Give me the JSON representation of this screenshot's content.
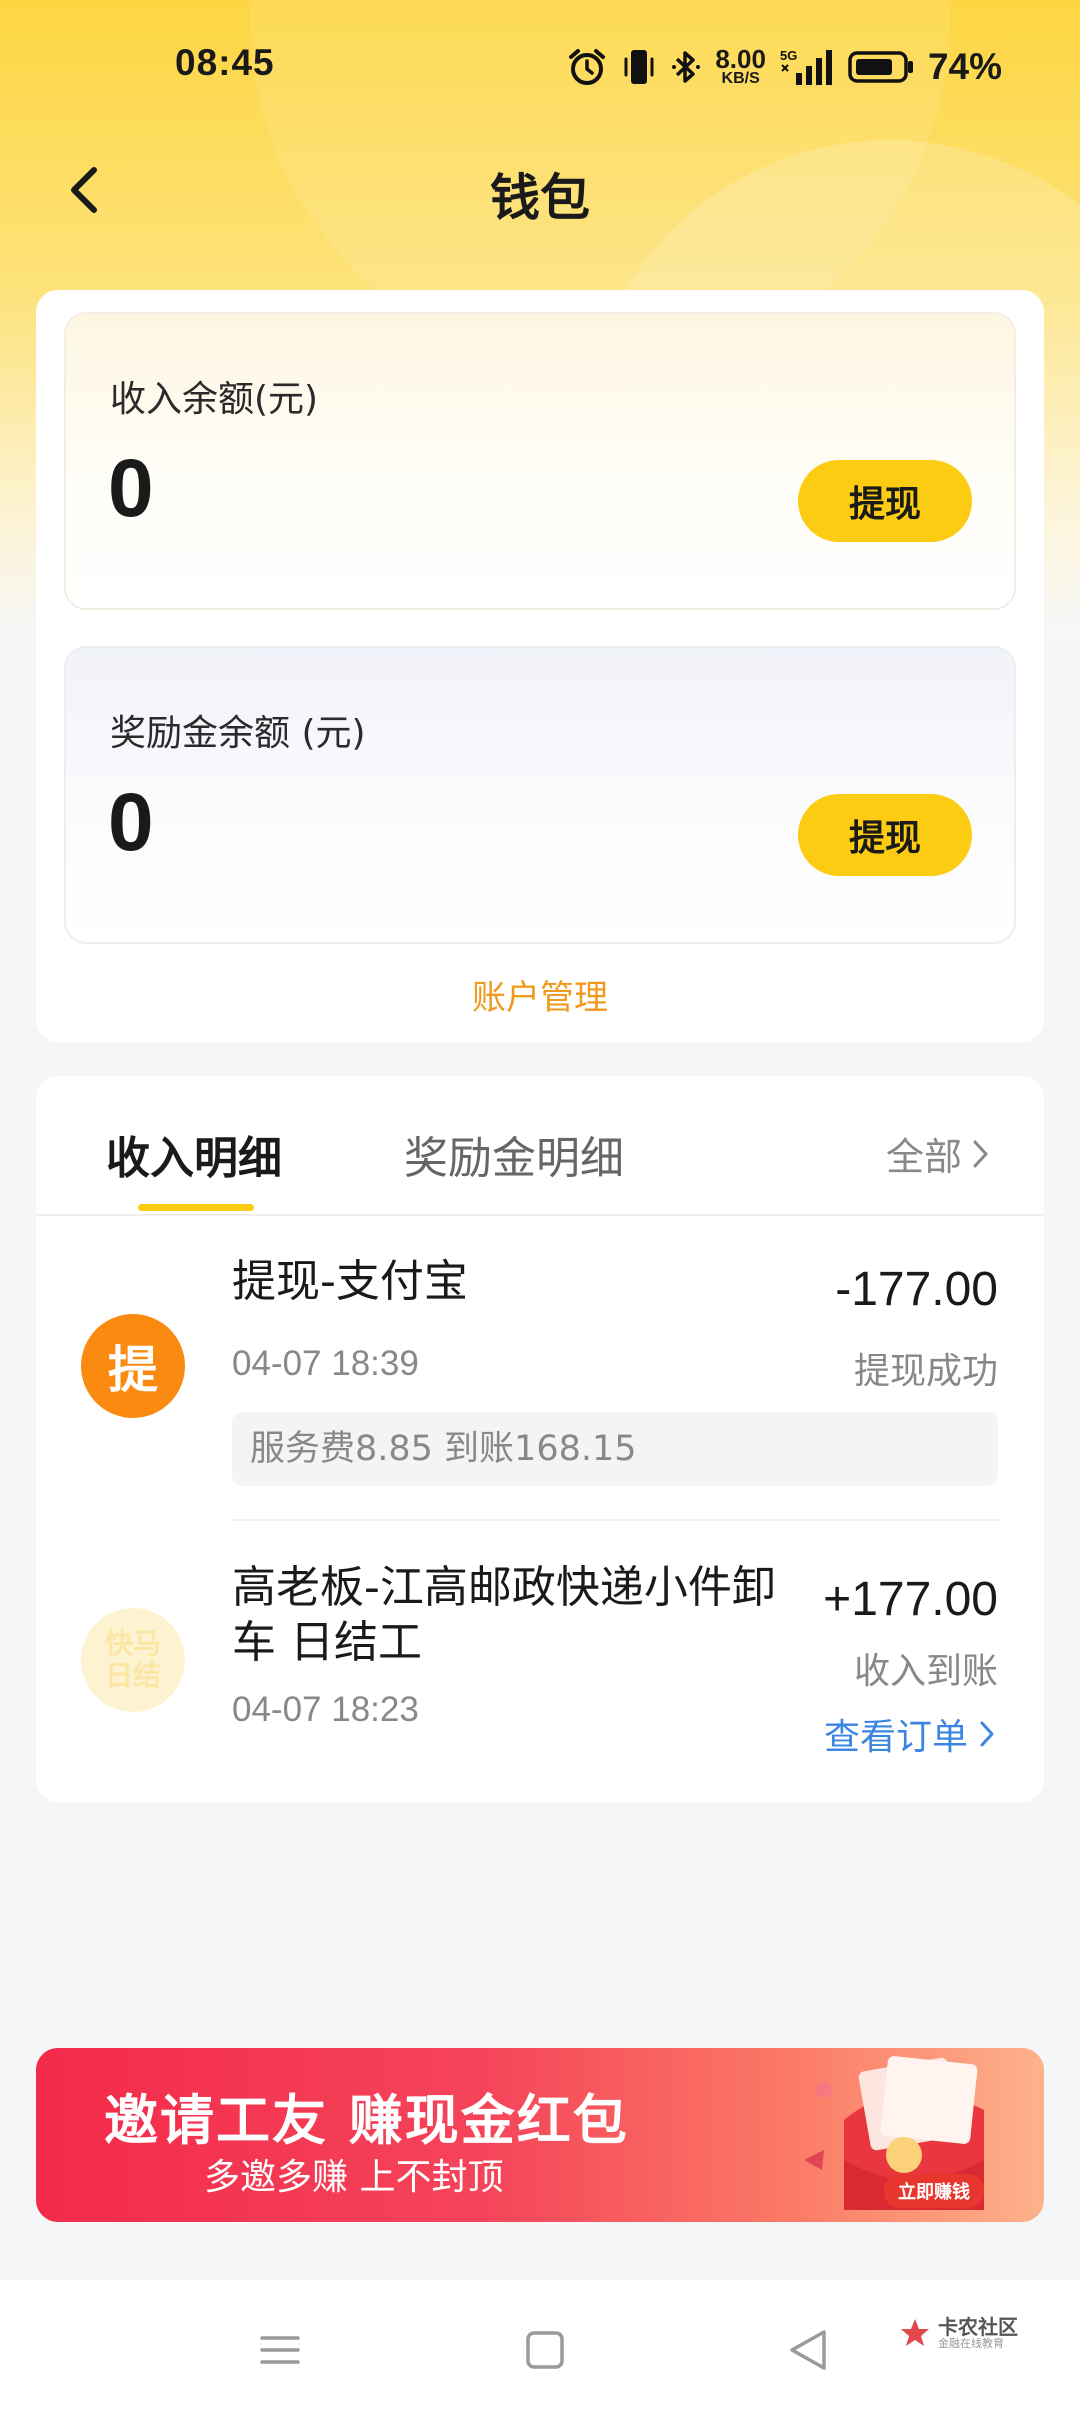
{
  "status_bar": {
    "time": "08:45",
    "net_speed_value": "8.00",
    "net_speed_unit": "KB/S",
    "network": "5G",
    "battery": "74%",
    "icons": [
      "alarm-icon",
      "vibrate-icon",
      "bluetooth-icon",
      "signal-icon",
      "battery-icon"
    ]
  },
  "nav": {
    "title": "钱包",
    "back_icon": "chevron-left-icon"
  },
  "balances": {
    "income": {
      "label": "收入余额(元)",
      "value": "0",
      "button": "提现"
    },
    "bonus": {
      "label": "奖励金余额 (元)",
      "value": "0",
      "button": "提现"
    },
    "account_management": "账户管理"
  },
  "details": {
    "tabs": [
      {
        "label": "收入明细",
        "active": true
      },
      {
        "label": "奖励金明细",
        "active": false
      }
    ],
    "all_label": "全部",
    "transactions": [
      {
        "avatar_text": "提",
        "title": "提现-支付宝",
        "time": "04-07 18:39",
        "amount": "-177.00",
        "status": "提现成功",
        "fee_note": "服务费8.85 到账168.15"
      },
      {
        "avatar_text_line1": "快马",
        "avatar_text_line2": "日结",
        "title": "高老板-江高邮政快递小件卸车 日结工",
        "time": "04-07 18:23",
        "amount": "+177.00",
        "status": "收入到账",
        "link": "查看订单"
      }
    ]
  },
  "banner": {
    "title": "邀请工友 赚现金红包",
    "subtitle": "多邀多赚 上不封顶",
    "button": "立即赚钱",
    "colors": {
      "start": "#f32a4a",
      "end": "#fdb28a"
    }
  },
  "system_nav": {
    "icons": [
      "menu-icon",
      "home-square-icon",
      "back-triangle-icon"
    ],
    "watermark_main": "卡农社区",
    "watermark_sub": "金融在线教育"
  },
  "colors": {
    "accent_yellow": "#fccc12",
    "orange": "#fa8a10",
    "link_blue": "#3b86e0",
    "account_orange": "#ef9a1e"
  }
}
